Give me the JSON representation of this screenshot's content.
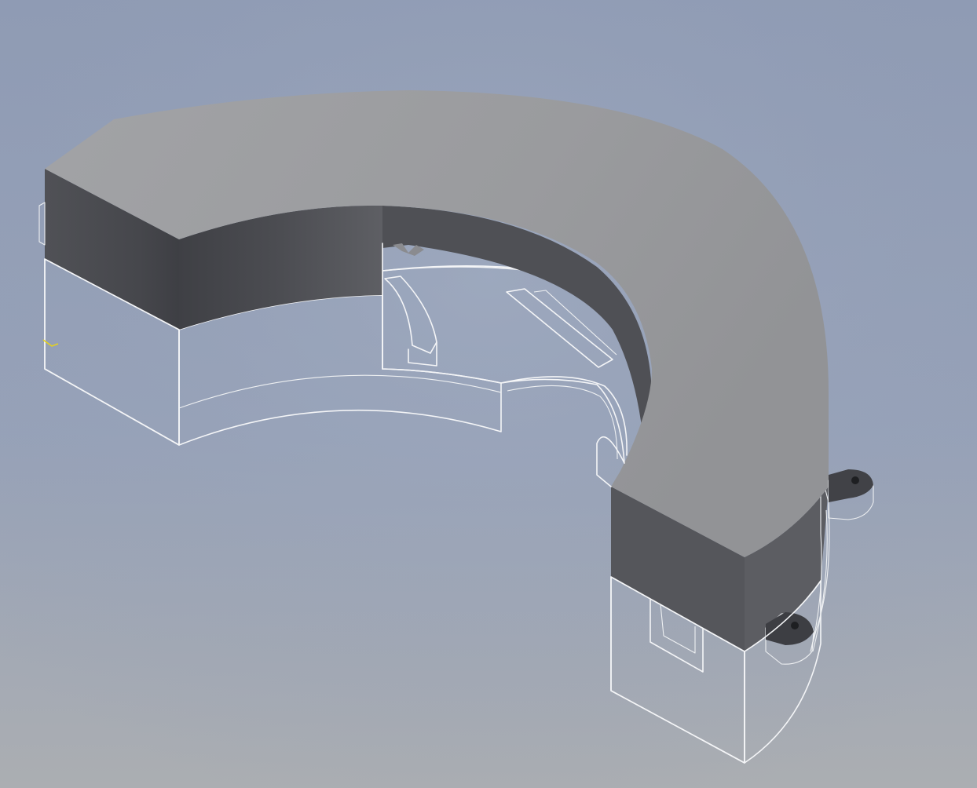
{
  "viewport": {
    "background_top": "#8e9cb6",
    "background_bottom": "#a9adb2",
    "model_top_face_color": "#9c9da0",
    "model_dark_band_color": "#4b4c51",
    "model_light_side_color": "#b6b6b9",
    "model_edge_color": "#f4f5f7",
    "triad_color": "#e6d21c"
  }
}
